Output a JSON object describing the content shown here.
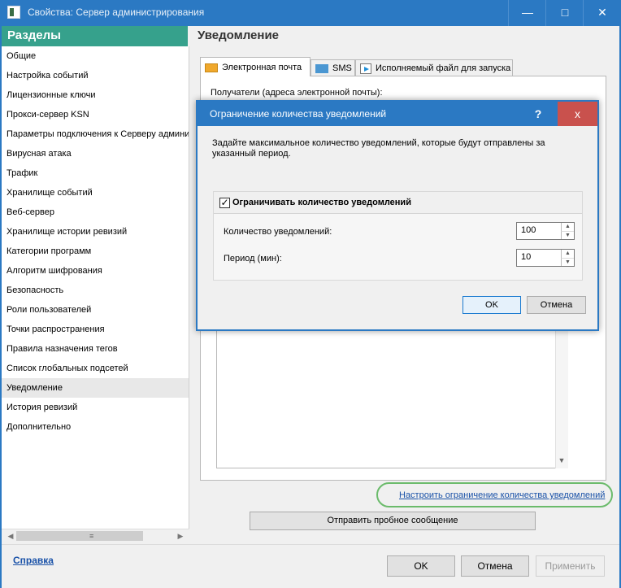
{
  "window": {
    "title": "Свойства: Сервер администрирования"
  },
  "sidebar": {
    "header": "Разделы",
    "items": [
      {
        "label": "Общие"
      },
      {
        "label": "Настройка событий"
      },
      {
        "label": "Лицензионные ключи"
      },
      {
        "label": "Прокси-сервер KSN"
      },
      {
        "label": "Параметры подключения к Серверу администрирования"
      },
      {
        "label": "Вирусная атака"
      },
      {
        "label": "Трафик"
      },
      {
        "label": "Хранилище событий"
      },
      {
        "label": "Веб-сервер"
      },
      {
        "label": "Хранилище истории ревизий"
      },
      {
        "label": "Категории программ"
      },
      {
        "label": "Алгоритм шифрования"
      },
      {
        "label": "Безопасность"
      },
      {
        "label": "Роли пользователей"
      },
      {
        "label": "Точки распространения"
      },
      {
        "label": "Правила назначения тегов"
      },
      {
        "label": "Список глобальных подсетей"
      },
      {
        "label": "Уведомление",
        "selected": true
      },
      {
        "label": "История ревизий"
      },
      {
        "label": "Дополнительно"
      }
    ],
    "help_link": "Справка"
  },
  "main": {
    "title": "Уведомление",
    "tabs": [
      {
        "label": "Электронная почта",
        "icon": "mail-icon",
        "active": true
      },
      {
        "label": "SMS",
        "icon": "sms-icon"
      },
      {
        "label": "Исполняемый файл для запуска",
        "icon": "executable-icon"
      }
    ],
    "recipients_label": "Получатели (адреса электронной почты):",
    "limit_link": "Настроить ограничение количества уведомлений",
    "test_button": "Отправить пробное сообщение"
  },
  "footer": {
    "ok": "OK",
    "cancel": "Отмена",
    "apply": "Применить"
  },
  "dialog": {
    "title": "Ограничение количества уведомлений",
    "help_button": "?",
    "close_button": "x",
    "description": "Задайте максимальное количество уведомлений, которые будут отправлены за указанный период.",
    "limit_checkbox_label": "Ограничивать количество уведомлений",
    "limit_checked": true,
    "count_label": "Количество уведомлений:",
    "count_value": "100",
    "period_label": "Период (мин):",
    "period_value": "10",
    "ok": "OK",
    "cancel": "Отмена"
  },
  "colors": {
    "titlebar": "#2b79c3",
    "sidebar_header": "#36a18c",
    "dialog_close": "#c9514d",
    "link": "#1a52a8",
    "highlight": "#6bbb6b"
  }
}
